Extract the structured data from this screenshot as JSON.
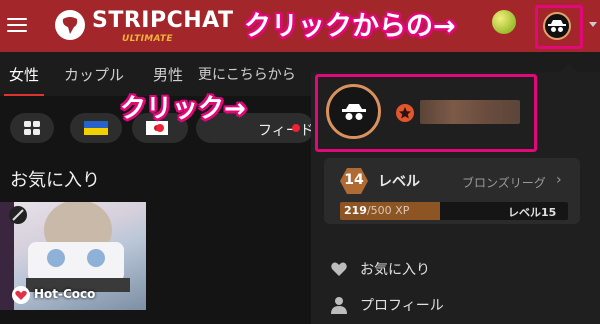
{
  "header": {
    "logo_text": "STRIPCHAT",
    "logo_sub": "ULTIMATE",
    "menu_icon": "hamburger-icon",
    "avatar_icon": "spy-avatar-icon"
  },
  "annotations": {
    "top_callout": "クリックからの→",
    "mid_callout": "クリック→",
    "color": "#e2077a"
  },
  "tabs": [
    {
      "label": "女性",
      "active": true
    },
    {
      "label": "カップル",
      "active": false
    },
    {
      "label": "男性",
      "active": false
    },
    {
      "label": "更にこちらから",
      "active": false
    }
  ],
  "filters": {
    "feed_label": "フィード"
  },
  "favorites": {
    "title": "お気に入り",
    "items": [
      {
        "name": "Hot-Coco"
      }
    ]
  },
  "dropdown": {
    "level_number": "14",
    "level_label": "レベル",
    "league": "ブロンズリーグ",
    "xp_current": "219",
    "xp_total": "/500 XP",
    "xp_progress": 0.438,
    "next_level": "レベル15",
    "menu": [
      {
        "label": "お気に入り",
        "icon": "heart-icon"
      },
      {
        "label": "プロフィール",
        "icon": "person-icon"
      }
    ]
  },
  "colors": {
    "topbar": "#a2262a",
    "accent_bronze": "#b06a34",
    "panel": "#1f1f1f"
  }
}
